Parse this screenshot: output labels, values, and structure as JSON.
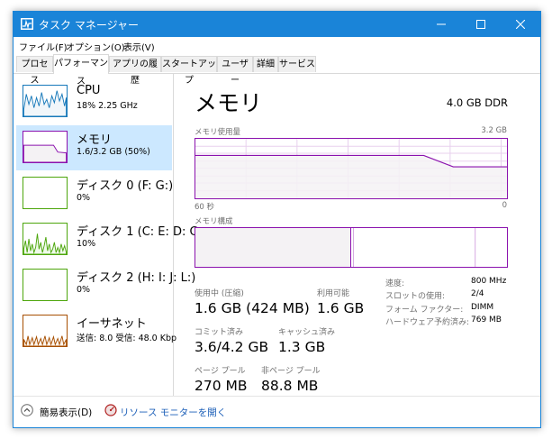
{
  "window": {
    "title": "タスク マネージャー",
    "accent": "#1a84d8"
  },
  "menu": [
    "ファイル(F)",
    "オプション(O)",
    "表示(V)"
  ],
  "tabs": [
    {
      "label": "プロセス",
      "active": false
    },
    {
      "label": "パフォーマンス",
      "active": true
    },
    {
      "label": "アプリの履歴",
      "active": false
    },
    {
      "label": "スタートアップ",
      "active": false
    },
    {
      "label": "ユーザー",
      "active": false
    },
    {
      "label": "詳細",
      "active": false
    },
    {
      "label": "サービス",
      "active": false
    }
  ],
  "sidebar": [
    {
      "name": "CPU",
      "sub": "18%  2.25 GHz",
      "color": "#1779ba",
      "selected": false
    },
    {
      "name": "メモリ",
      "sub": "1.6/3.2 GB (50%)",
      "color": "#8b12ae",
      "selected": true
    },
    {
      "name": "ディスク 0 (F: G:)",
      "sub": "0%",
      "color": "#4da60c",
      "selected": false
    },
    {
      "name": "ディスク 1 (C: E: D: C",
      "sub": "10%",
      "color": "#4da60c",
      "selected": false
    },
    {
      "name": "ディスク 2 (H: I: J: L:)",
      "sub": "0%",
      "color": "#4da60c",
      "selected": false
    },
    {
      "name": "イーサネット",
      "sub": "送信: 8.0  受信: 48.0 Kbp",
      "color": "#a74f01",
      "selected": false
    }
  ],
  "main": {
    "title": "メモリ",
    "capacity": "4.0 GB DDR",
    "usage_label": "メモリ使用量",
    "usage_max": "3.2 GB",
    "time_left": "60 秒",
    "time_right": "0",
    "composition_label": "メモリ構成",
    "stats": {
      "in_use_label": "使用中 (圧縮)",
      "in_use": "1.6 GB (424 MB)",
      "available_label": "利用可能",
      "available": "1.6 GB",
      "committed_label": "コミット済み",
      "committed": "3.6/4.2 GB",
      "cached_label": "キャッシュ済み",
      "cached": "1.3 GB",
      "paged_label": "ページ プール",
      "paged": "270 MB",
      "nonpaged_label": "非ページ プール",
      "nonpaged": "88.8 MB"
    },
    "specs": [
      {
        "key": "速度:",
        "value": "800 MHz"
      },
      {
        "key": "スロットの使用:",
        "value": "2/4"
      },
      {
        "key": "フォーム ファクター:",
        "value": "DIMM"
      },
      {
        "key": "ハードウェア予約済み:",
        "value": "769 MB"
      }
    ]
  },
  "footer": {
    "fewer_details": "簡易表示(D)",
    "resource_monitor": "リソース モニターを開く"
  }
}
